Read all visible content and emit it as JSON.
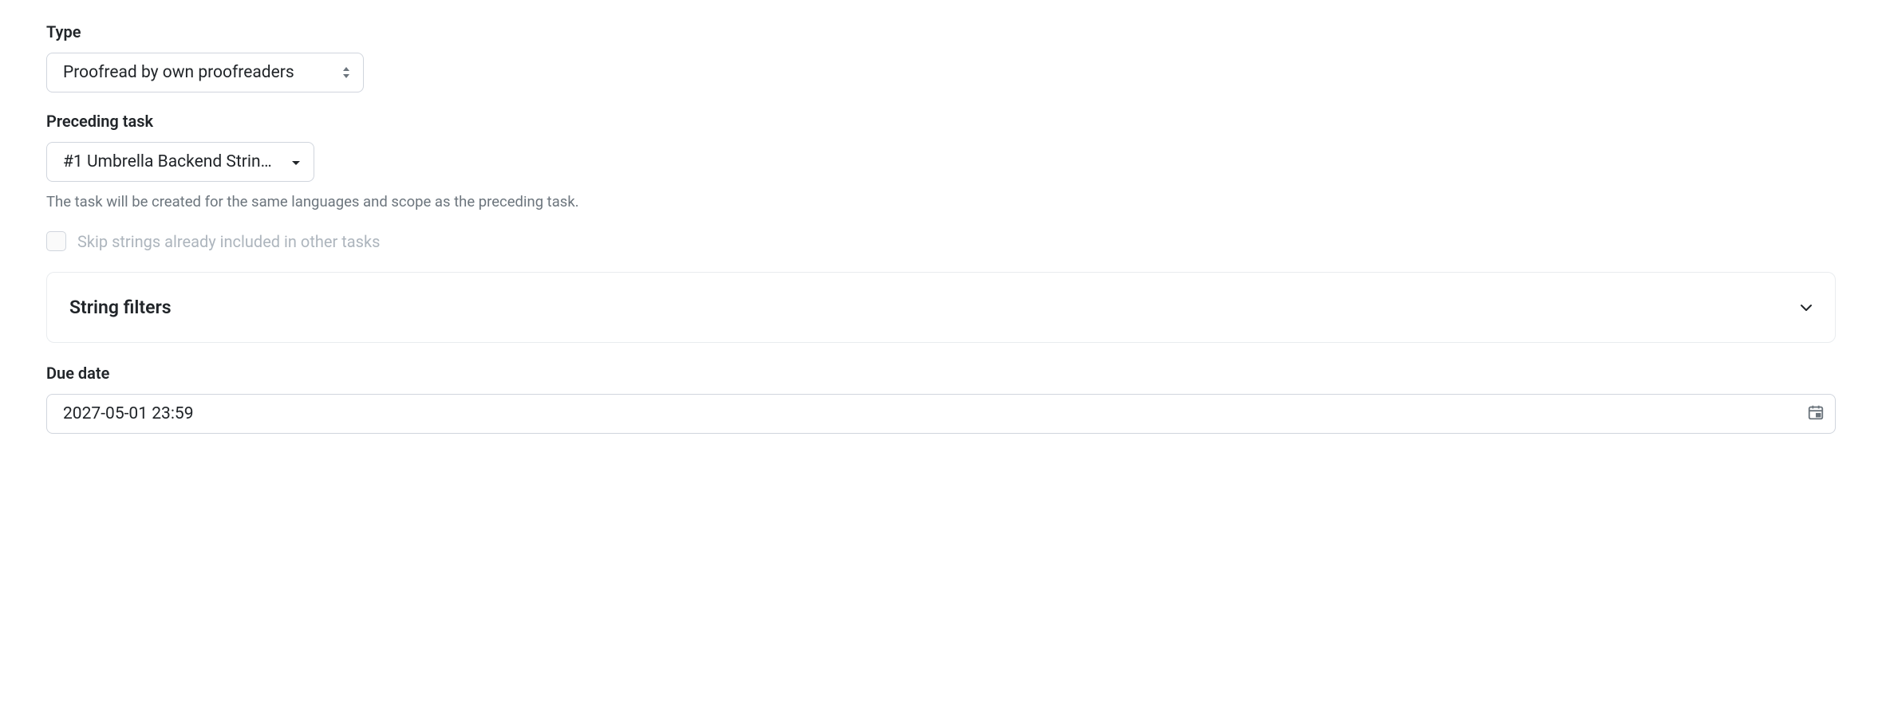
{
  "type": {
    "label": "Type",
    "value": "Proofread by own proofreaders"
  },
  "preceding_task": {
    "label": "Preceding task",
    "value": "#1 Umbrella Backend String…",
    "help_text": "The task will be created for the same languages and scope as the preceding task."
  },
  "skip_strings": {
    "label": "Skip strings already included in other tasks"
  },
  "string_filters": {
    "title": "String filters"
  },
  "due_date": {
    "label": "Due date",
    "value": "2027-05-01 23:59"
  }
}
